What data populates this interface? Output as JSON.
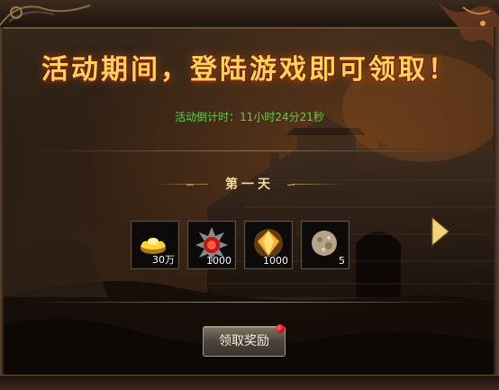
{
  "event": {
    "headline": "活动期间，登陆游戏即可领取！",
    "countdown_label": "活动倒计时：",
    "countdown_value": "11小时24分21秒"
  },
  "day": {
    "title": "第一天"
  },
  "rewards": [
    {
      "icon": "gold-ingot-icon",
      "count": "30万"
    },
    {
      "icon": "emblem-shield-icon",
      "count": "1000"
    },
    {
      "icon": "orange-gem-icon",
      "count": "1000"
    },
    {
      "icon": "stone-orb-icon",
      "count": "5"
    }
  ],
  "claim_button": {
    "label": "领取奖励"
  },
  "colors": {
    "headline": "#ffd25a",
    "countdown": "#5fd04a",
    "notification_dot": "#d41010"
  }
}
